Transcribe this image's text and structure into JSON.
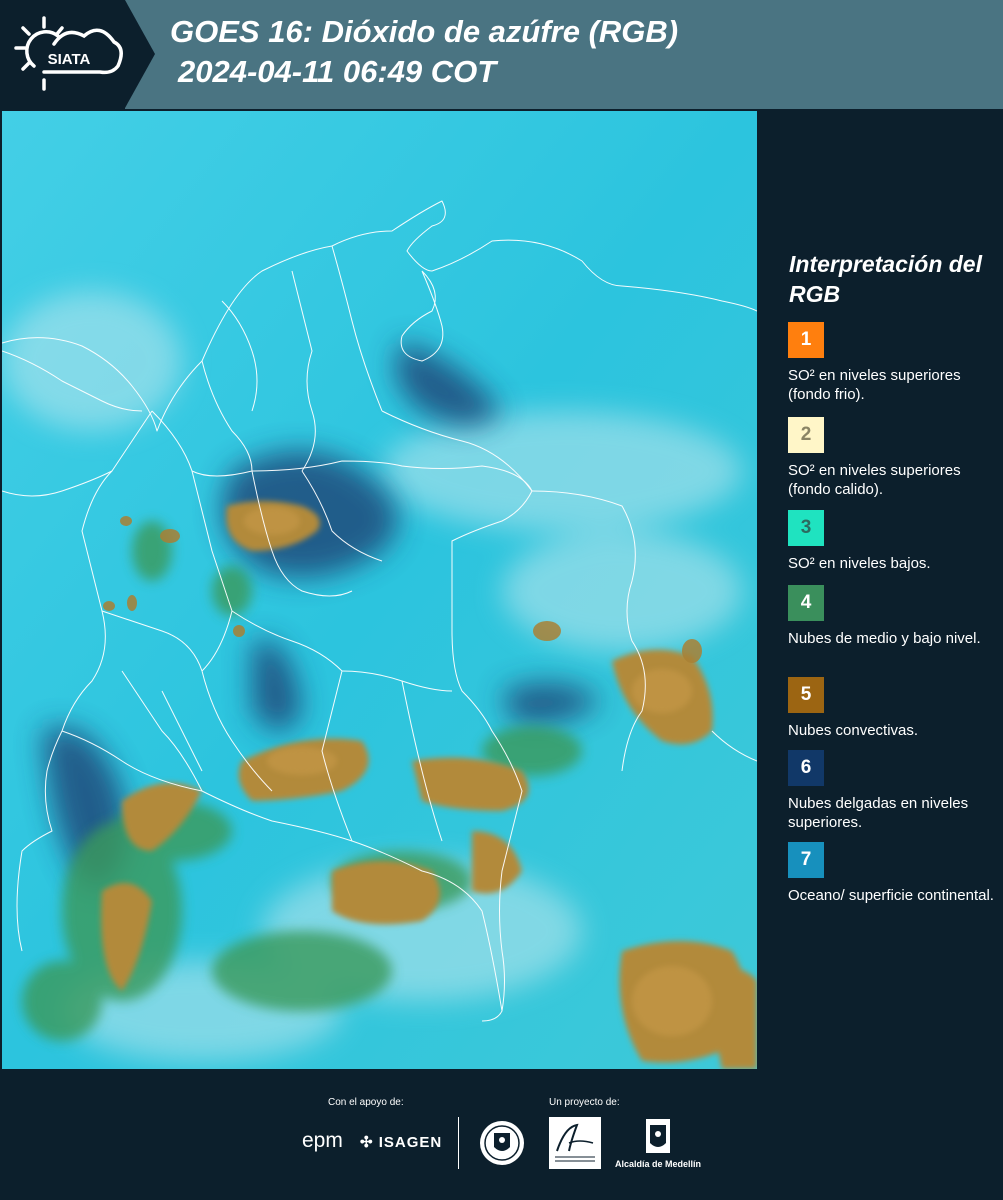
{
  "header": {
    "logo_text": "SIATA",
    "title_line1": "GOES 16: Dióxido de azúfre (RGB)",
    "title_line2": "2024-04-11 06:49 COT"
  },
  "map": {
    "base_color": "#2bc7e0",
    "cloud_colors": [
      "#b28a3a",
      "#3d8f5a",
      "#2c3f6a",
      "#bfe7ee"
    ],
    "border_color": "#ffffff"
  },
  "legend": {
    "title": "Interpretación del RGB",
    "items": [
      {
        "number": "1",
        "color": "#ff7f0e",
        "number_color": "#ffffff",
        "text": "SO² en niveles superiores (fondo frio)."
      },
      {
        "number": "2",
        "color": "#fff6c8",
        "number_color": "#8a8465",
        "text": "SO² en niveles superiores (fondo calido)."
      },
      {
        "number": "3",
        "color": "#1fe3c0",
        "number_color": "#2c6b60",
        "text": "SO² en niveles bajos."
      },
      {
        "number": "4",
        "color": "#3a8f5c",
        "number_color": "#ffffff",
        "text": "Nubes de medio y bajo nivel."
      },
      {
        "number": "5",
        "color": "#9c6512",
        "number_color": "#ffffff",
        "text": "Nubes convectivas."
      },
      {
        "number": "6",
        "color": "#113868",
        "number_color": "#ffffff",
        "text": "Nubes delgadas en niveles superiores."
      },
      {
        "number": "7",
        "color": "#1790bd",
        "number_color": "#ffffff",
        "text": "Oceano/ superficie continental."
      }
    ]
  },
  "footer": {
    "support_label": "Con el apoyo de:",
    "project_label": "Un proyecto de:",
    "epm": "epm",
    "isagen": "ISAGEN",
    "alcaldia": "Alcaldía de Medellín"
  }
}
